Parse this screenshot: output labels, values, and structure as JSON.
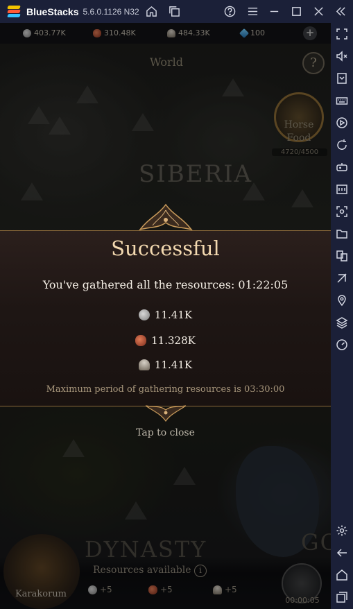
{
  "titlebar": {
    "app_name": "BlueStacks",
    "version": "5.6.0.1126 N32",
    "icons": [
      "home-icon",
      "multi-instance-icon",
      "help-icon",
      "menu-icon",
      "minimize-icon",
      "maximize-icon",
      "close-icon",
      "collapse-sidebar-icon"
    ]
  },
  "sidebar": {
    "icons": [
      "fullscreen-icon",
      "volume-icon",
      "install-apk-icon",
      "keyboard-icon",
      "macro-icon",
      "rotate-icon",
      "gamepad-icon",
      "apk-icon",
      "screenshot-icon",
      "folder-icon",
      "multi-instance-sync-icon",
      "eco-mode-icon",
      "location-icon",
      "layers-icon",
      "speed-icon",
      "settings-icon",
      "back-icon",
      "android-home-icon",
      "recents-icon"
    ]
  },
  "game": {
    "resources": {
      "silver": "403.77K",
      "food": "310.48K",
      "soldiers": "484.33K",
      "gems": "100"
    },
    "map_title": "World",
    "help_label": "?",
    "horse_food": {
      "label": "Horse Food",
      "count": "4720/4500"
    },
    "regions": {
      "siberia": "SIBERIA",
      "dynasty": "DYNASTY",
      "go": "GO"
    }
  },
  "modal": {
    "title": "Successful",
    "message": "You've gathered all the resources: 01:22:05",
    "items": [
      {
        "icon": "silver-coin-icon",
        "amount": "11.41K"
      },
      {
        "icon": "meat-icon",
        "amount": "11.328K"
      },
      {
        "icon": "helmet-icon",
        "amount": "11.41K"
      }
    ],
    "note": "Maximum period of gathering resources is 03:30:00",
    "tap_to_close": "Tap to close"
  },
  "bottom": {
    "city_name": "Karakorum",
    "resources_available": "Resources available",
    "bonuses": [
      "+5",
      "+5",
      "+5"
    ],
    "march_timer": "00:00:05"
  },
  "colors": {
    "bluestacks_bar": "#1b2038",
    "modal_title": "#f3d9b0",
    "modal_border": "#8c6a3a"
  }
}
